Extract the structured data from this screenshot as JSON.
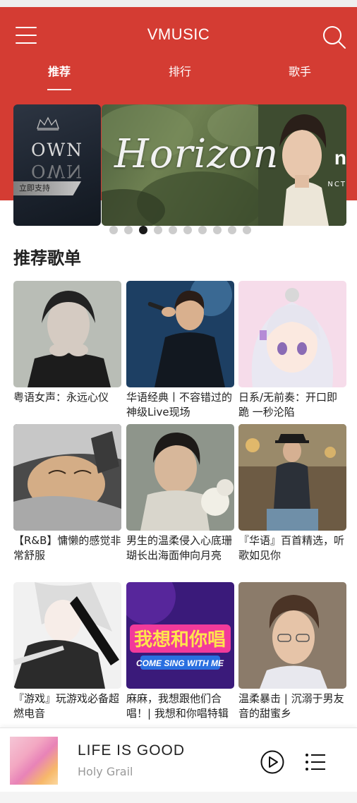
{
  "app": {
    "title": "VMUSIC",
    "accent_color": "#d43c33"
  },
  "header": {
    "menu_icon": "hamburger-menu-icon",
    "search_icon": "search-icon"
  },
  "tabs": [
    {
      "label": "推荐",
      "active": true
    },
    {
      "label": "排行",
      "active": false
    },
    {
      "label": "歌手",
      "active": false
    }
  ],
  "carousel": {
    "prev_banner": {
      "text": "OWN",
      "button_label": "立即支持"
    },
    "main_banner": {
      "text": "Horizon",
      "badge": "NCT"
    },
    "dot_count": 10,
    "active_index": 2
  },
  "section": {
    "title": "推荐歌单"
  },
  "playlists": [
    {
      "title": "粤语女声：永远心仪"
    },
    {
      "title": "华语经典丨不容错过的神级Live现场"
    },
    {
      "title": "日系/无前奏：开口即跪 一秒沦陷"
    },
    {
      "title": "【R&B】慵懒的感觉非常舒服"
    },
    {
      "title": "男生的温柔侵入心底珊瑚长出海面伸向月亮"
    },
    {
      "title": "『华语』百首精选，听歌如见你"
    },
    {
      "title": "『游戏』玩游戏必备超燃电音"
    },
    {
      "title": "麻麻，我想跟他们合唱！| 我想和你唱特辑"
    },
    {
      "title": "温柔暴击 | 沉溺于男友音的甜蜜乡"
    }
  ],
  "player": {
    "song": "LIFE IS GOOD",
    "artist": "Holy Grail",
    "play_icon": "play-icon",
    "playlist_icon": "playlist-icon"
  }
}
